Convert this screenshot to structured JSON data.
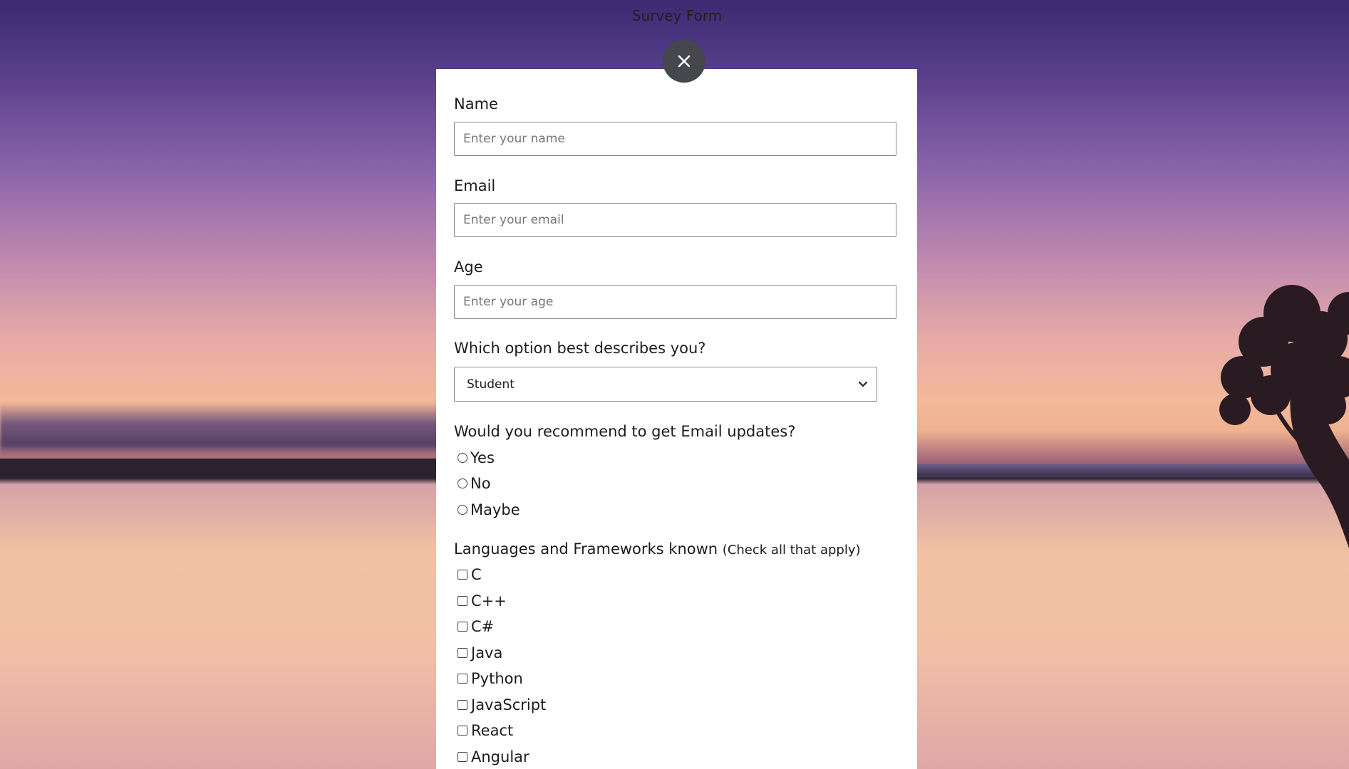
{
  "page": {
    "title": "Survey Form"
  },
  "close": {
    "icon": "close-icon"
  },
  "form": {
    "name": {
      "label": "Name",
      "placeholder": "Enter your name"
    },
    "email": {
      "label": "Email",
      "placeholder": "Enter your email"
    },
    "age": {
      "label": "Age",
      "placeholder": "Enter your age"
    },
    "role": {
      "label": "Which option best describes you?",
      "selected": "Student",
      "icon": "chevron-down-icon"
    },
    "recommend": {
      "label": "Would you recommend to get Email updates?",
      "options": [
        "Yes",
        "No",
        "Maybe"
      ]
    },
    "languages": {
      "label": "Languages and Frameworks known",
      "hint": "(Check all that apply)",
      "options": [
        "C",
        "C++",
        "C#",
        "Java",
        "Python",
        "JavaScript",
        "React",
        "Angular"
      ]
    }
  },
  "colors": {
    "close_button_bg": "#45474d",
    "card_bg": "#ffffff"
  }
}
